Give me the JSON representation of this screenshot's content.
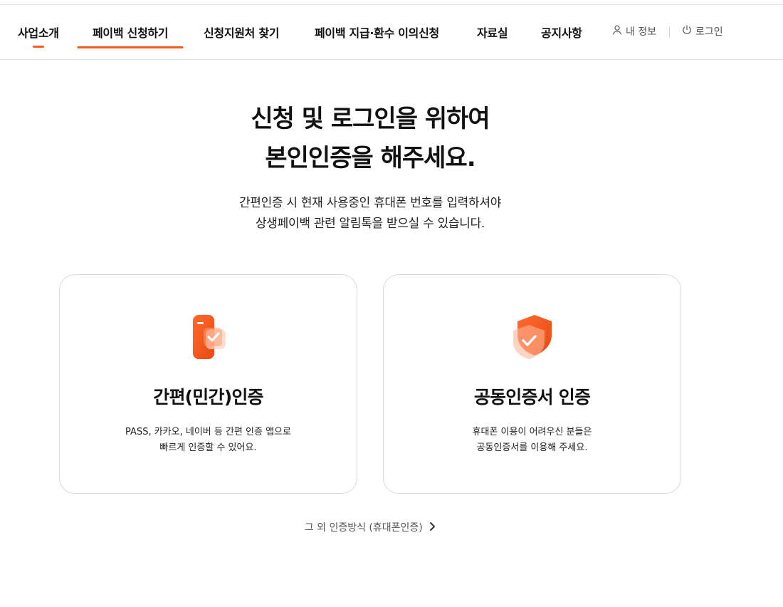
{
  "nav": {
    "items": [
      {
        "label": "사업소개"
      },
      {
        "label": "페이백 신청하기"
      },
      {
        "label": "신청지원처 찾기"
      },
      {
        "label": "페이백 지급·환수 이의신청"
      },
      {
        "label": "자료실"
      },
      {
        "label": "공지사항"
      }
    ],
    "my_info": "내 정보",
    "login": "로그인"
  },
  "main": {
    "headline_line1": "신청 및 로그인을 위하여",
    "headline_line2": "본인인증을 해주세요.",
    "sub_line1": "간편인증 시 현재 사용중인 휴대폰 번호를 입력하셔야",
    "sub_line2": "상생페이백 관련 알림톡을 받으실 수 있습니다.",
    "cards": [
      {
        "title": "간편(민간)인증",
        "desc_line1": "PASS, 카카오, 네이버 등 간편 인증 앱으로",
        "desc_line2": "빠르게 인증할 수 있어요.",
        "icon": "phone-check-icon"
      },
      {
        "title": "공동인증서 인증",
        "desc_line1": "휴대폰 이용이 어려우신 분들은",
        "desc_line2": "공동인증서를 이용해 주세요.",
        "icon": "shield-check-icon"
      }
    ],
    "other_method": "그 외 인증방식 (휴대폰인증)"
  },
  "colors": {
    "accent": "#f25a22",
    "card_border": "#d9d9d9"
  }
}
